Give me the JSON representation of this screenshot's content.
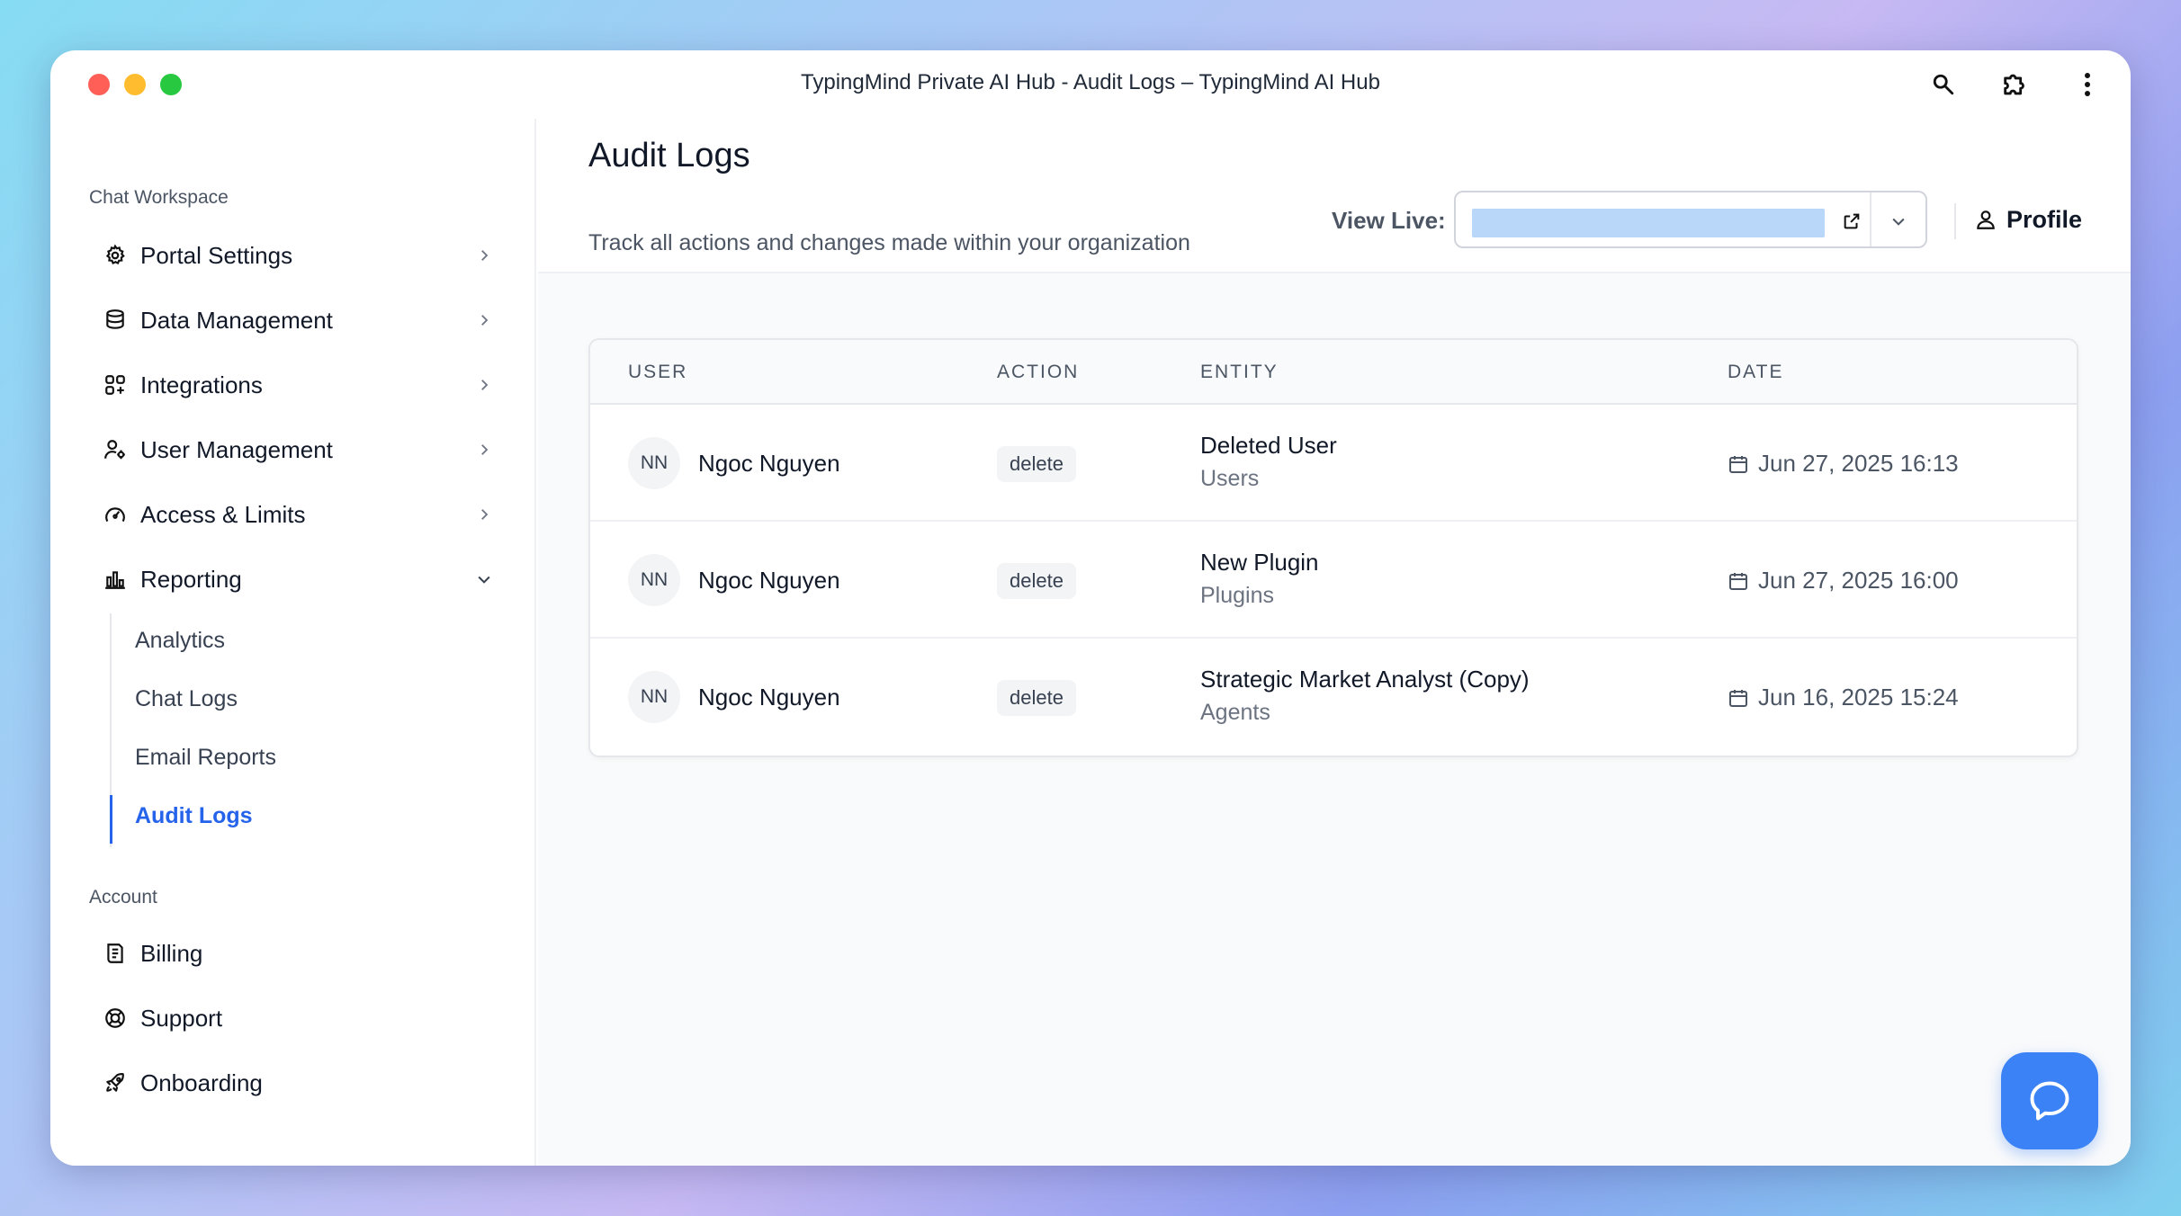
{
  "window": {
    "title": "TypingMind Private AI Hub - Audit Logs – TypingMind AI Hub"
  },
  "sidebar": {
    "section_chat": "Chat Workspace",
    "items": [
      {
        "label": "Portal Settings",
        "icon": "gear-icon"
      },
      {
        "label": "Data Management",
        "icon": "database-icon"
      },
      {
        "label": "Integrations",
        "icon": "grid-plus-icon"
      },
      {
        "label": "User Management",
        "icon": "users-gear-icon"
      },
      {
        "label": "Access & Limits",
        "icon": "gauge-icon"
      },
      {
        "label": "Reporting",
        "icon": "bar-chart-icon"
      }
    ],
    "reporting_sub": [
      {
        "label": "Analytics"
      },
      {
        "label": "Chat Logs"
      },
      {
        "label": "Email Reports"
      },
      {
        "label": "Audit Logs"
      }
    ],
    "section_account": "Account",
    "account_items": [
      {
        "label": "Billing",
        "icon": "receipt-icon"
      },
      {
        "label": "Support",
        "icon": "lifebuoy-icon"
      },
      {
        "label": "Onboarding",
        "icon": "rocket-icon"
      }
    ]
  },
  "header": {
    "title": "Audit Logs",
    "subtitle": "Track all actions and changes made within your organization",
    "view_live_label": "View Live:",
    "profile_label": "Profile"
  },
  "table": {
    "columns": [
      "USER",
      "ACTION",
      "ENTITY",
      "DATE"
    ],
    "rows": [
      {
        "initials": "NN",
        "user": "Ngoc Nguyen",
        "action": "delete",
        "entity": "Deleted User",
        "entity_type": "Users",
        "date": "Jun 27, 2025 16:13"
      },
      {
        "initials": "NN",
        "user": "Ngoc Nguyen",
        "action": "delete",
        "entity": "New Plugin",
        "entity_type": "Plugins",
        "date": "Jun 27, 2025 16:00"
      },
      {
        "initials": "NN",
        "user": "Ngoc Nguyen",
        "action": "delete",
        "entity": "Strategic Market Analyst (Copy)",
        "entity_type": "Agents",
        "date": "Jun 16, 2025 15:24"
      }
    ]
  },
  "colors": {
    "accent": "#2563eb",
    "fab": "#3b82f6"
  }
}
